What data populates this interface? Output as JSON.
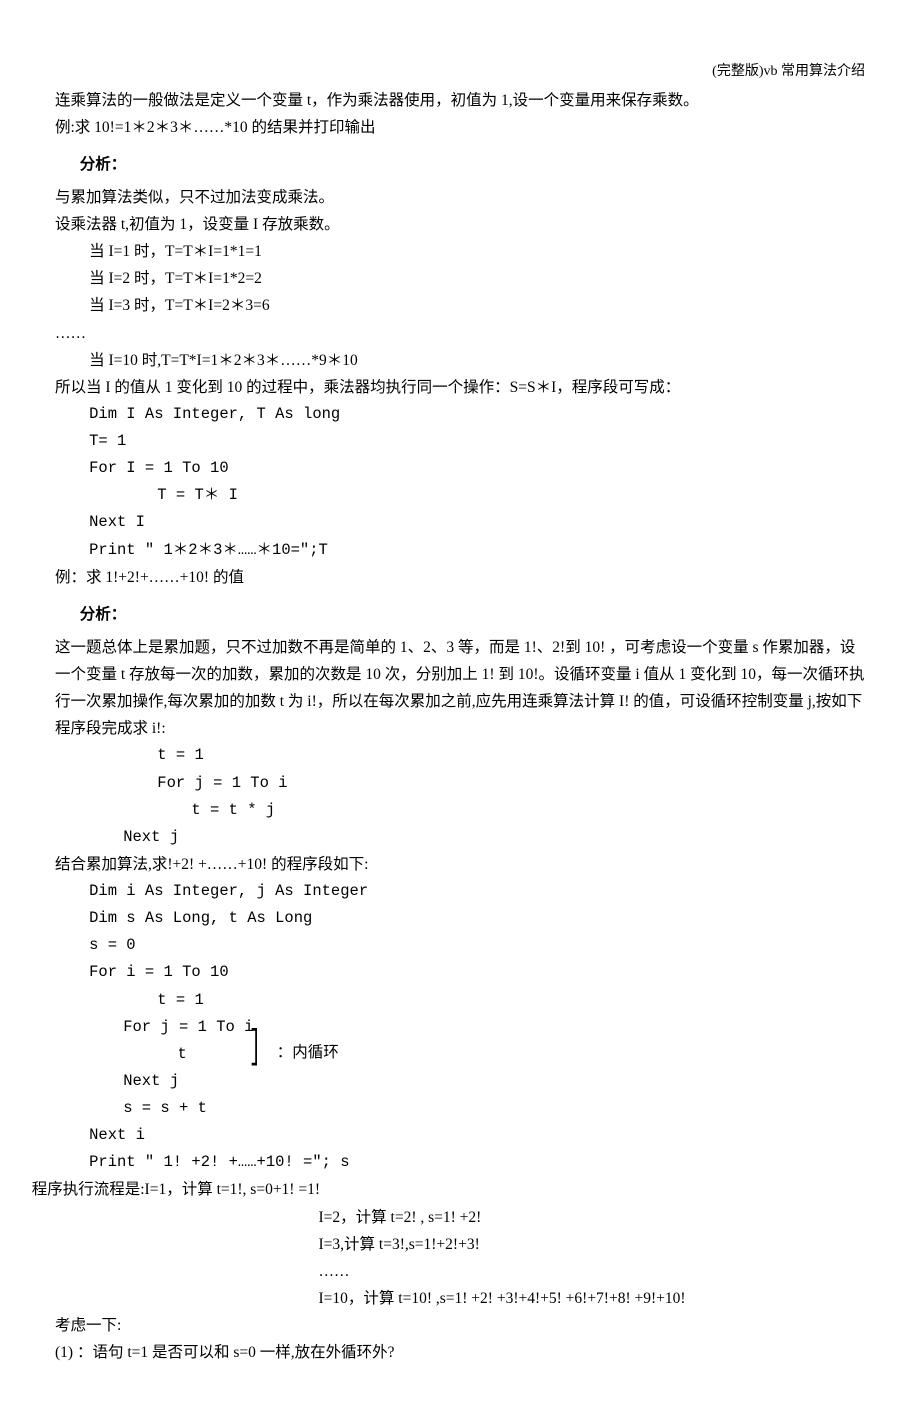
{
  "header": {
    "title": "(完整版)vb 常用算法介绍"
  },
  "intro": {
    "line1": "连乘算法的一般做法是定义一个变量 t，作为乘法器使用，初值为 1,设一个变量用来保存乘数。",
    "line2": "例:求 10!=1＊2＊3＊……*10 的结果并打印输出"
  },
  "section1": {
    "title": "分析：",
    "line1": "与累加算法类似，只不过加法变成乘法。",
    "line2": "设乘法器 t,初值为 1，设变量 I 存放乘数。",
    "step1": "当 I=1 时，T=T＊I=1*1=1",
    "step2": "当 I=2 时，T=T＊I=1*2=2",
    "step3": "当 I=3 时，T=T＊I=2＊3=6",
    "dots": "……",
    "step10": "当 I=10 时,T=T*I=1＊2＊3＊……*9＊10",
    "line3": "所以当 I 的值从 1 变化到 10 的过程中，乘法器均执行同一个操作：S=S＊I，程序段可写成：",
    "code1": "Dim I As Integer, T As long",
    "code2": "T= 1",
    "code3": "For I = 1 To 10",
    "code4": "T = T＊ I",
    "code5": "Next I",
    "code6": "Print \" 1＊2＊3＊……＊10=\";T",
    "line4": "例：求 1!+2!+……+10! 的值"
  },
  "section2": {
    "title": "分析：",
    "para": "这一题总体上是累加题，只不过加数不再是简单的 1、2、3 等，而是 1!、2!到 10! ，可考虑设一个变量 s 作累加器，设一个变量 t 存放每一次的加数，累加的次数是 10 次，分别加上 1! 到 10!。设循环变量 i 值从 1 变化到 10，每一次循环执行一次累加操作,每次累加的加数 t 为 i!，所以在每次累加之前,应先用连乘算法计算 I! 的值，可设循环控制变量 j,按如下程序段完成求 i!:",
    "code1": "t = 1",
    "code2": "For j = 1 To i",
    "code3": "t = t * j",
    "code4": "Next j",
    "line2": "结合累加算法,求!+2! +……+10! 的程序段如下:",
    "codeb1": "Dim i As Integer,  j As Integer",
    "codeb2": "Dim s As Long, t As Long",
    "codeb3": "s = 0",
    "codeb4": "For i = 1 To 10",
    "codeb5": "t = 1",
    "codeb6": "For j = 1 To i",
    "codeb7": "t",
    "codeb8": "Next j",
    "bracket_label": "：内循环",
    "codeb9": "s = s + t",
    "codeb10": "Next i",
    "codeb11": "Print \" 1! +2! +……+10! =\";  s",
    "flow1": "程序执行流程是:I=1，计算 t=1!, s=0+1! =1!",
    "flow2": "I=2，计算 t=2! , s=1! +2!",
    "flow3": "I=3,计算 t=3!,s=1!+2!+3!",
    "flow4": "……",
    "flow5": "I=10，计算 t=10! ,s=1! +2! +3!+4!+5! +6!+7!+8! +9!+10!",
    "think": "考虑一下:",
    "q1": "(1) ：语句 t=1 是否可以和 s=0 一样,放在外循环外?"
  }
}
